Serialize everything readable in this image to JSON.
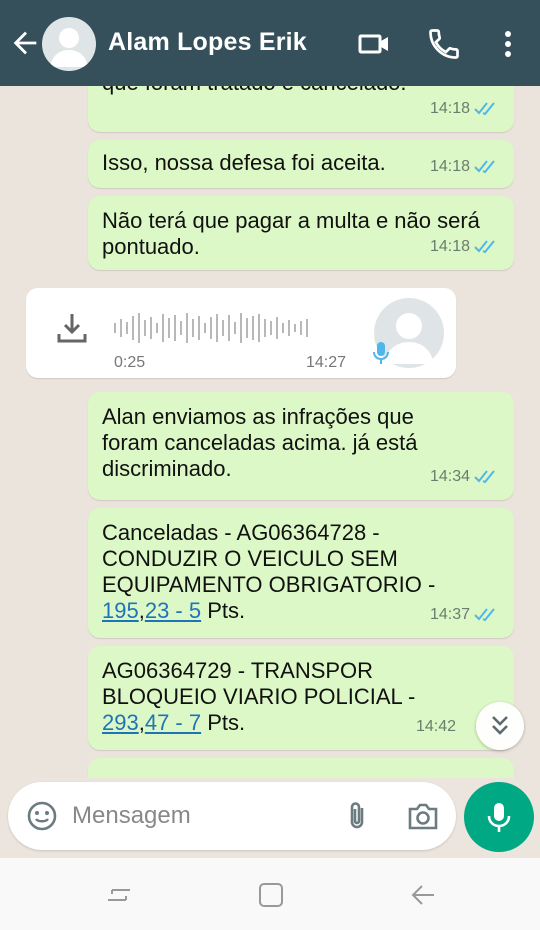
{
  "header": {
    "contact_name": "Alam Lopes Erik",
    "icons": [
      "back-arrow-icon",
      "avatar",
      "video-call-icon",
      "phone-icon",
      "more-vert-icon"
    ]
  },
  "messages": [
    {
      "text": "que foram tratado e cancelado.",
      "time": "14:18",
      "status": "read"
    },
    {
      "text": "Isso, nossa defesa foi aceita.",
      "time": "14:18",
      "status": "read"
    },
    {
      "text": "Não terá que pagar a multa e não será pontuado.",
      "time": "14:18",
      "status": "read"
    },
    {
      "text": "Alan enviamos as infrações que foram canceladas acima. já está discriminado.",
      "time": "14:34",
      "status": "read"
    },
    {
      "line1": "Canceladas - AG06364728 -",
      "line2": "CONDUZIR O VEICULO SEM",
      "line3": "EQUIPAMENTO OBRIGATORIO -",
      "link1": "195",
      "sep": ",",
      "link2": "23 - 5",
      "suffix": " Pts.",
      "time": "14:37",
      "status": "read"
    },
    {
      "line1": "AG06364729 - TRANSPOR",
      "line2": "BLOQUEIO VIARIO POLICIAL -",
      "link1": "293",
      "sep": ",",
      "link2": "47 - 7",
      "suffix": " Pts.",
      "time": "14:42",
      "status": "read"
    }
  ],
  "voice_note": {
    "duration": "0:25",
    "time": "14:27"
  },
  "composer": {
    "placeholder": "Mensagem"
  },
  "colors": {
    "header": "#35505a",
    "outgoing_bubble": "#dcf8c6",
    "accent": "#00a884",
    "read_tick": "#4fb6ec",
    "link": "#1f73b8"
  },
  "navbar": {
    "icons": [
      "recent-apps-icon",
      "home-icon",
      "back-icon"
    ]
  }
}
